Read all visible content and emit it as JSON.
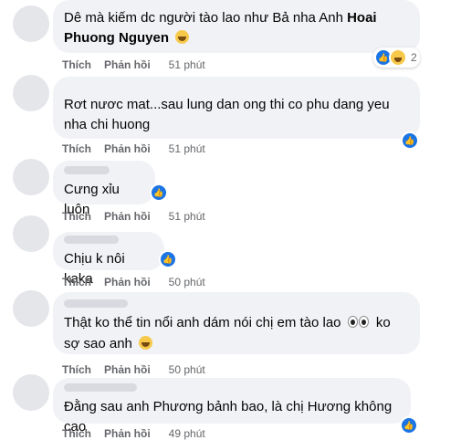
{
  "comments": [
    {
      "text_before": "Dê mà kiếm dc người tào lao như Bả nha Anh ",
      "mention": "Hoai Phuong Nguyen",
      "like_label": "Thích",
      "reply_label": "Phản hồi",
      "time": "51 phút",
      "reaction_count": "2"
    },
    {
      "text": "Rơt nươc mat...sau lung dan ong thi co phu dang yeu nha chi huong",
      "like_label": "Thích",
      "reply_label": "Phản hồi",
      "time": "51 phút"
    },
    {
      "text": "Cưng xỉu luôn",
      "like_label": "Thích",
      "reply_label": "Phản hồi",
      "time": "51 phút"
    },
    {
      "text": "Chịu k nôi kaka",
      "like_label": "Thích",
      "reply_label": "Phản hồi",
      "time": "50 phút"
    },
    {
      "text_before": "Thật ko thể tin nổi anh dám nói chị em tào lao",
      "text_after": "ko sợ sao anh",
      "like_label": "Thích",
      "reply_label": "Phản hồi",
      "time": "50 phút"
    },
    {
      "text": "Đằng sau anh Phương bảnh bao, là chị Hương không cao",
      "like_label": "Thích",
      "reply_label": "Phản hồi",
      "time": "49 phút"
    }
  ],
  "colors": {
    "bubble": "#f0f2f5",
    "meta": "#65676b",
    "like_blue": "#1b74e4"
  }
}
